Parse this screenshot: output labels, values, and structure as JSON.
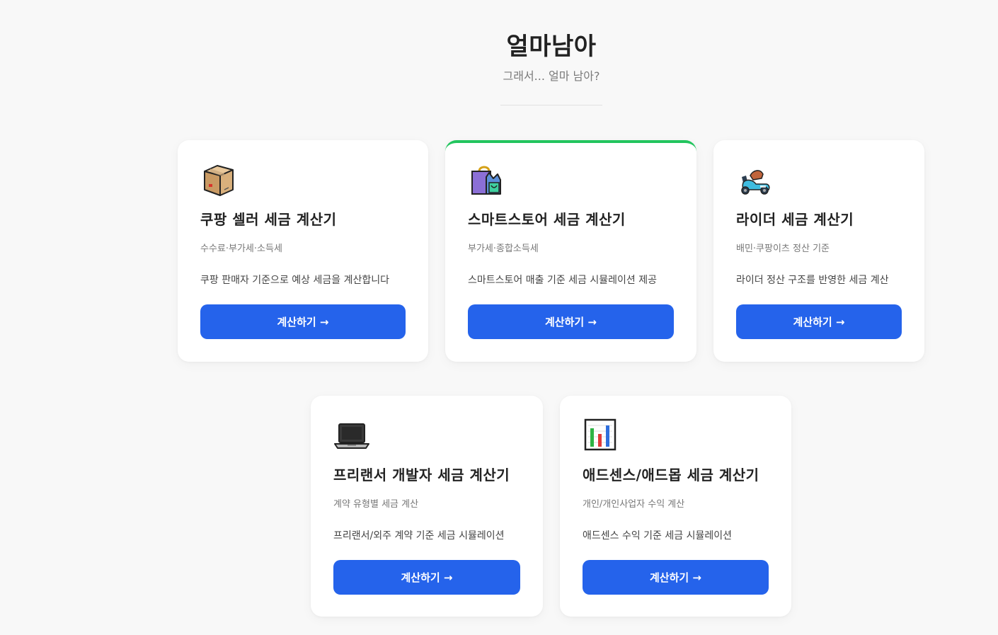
{
  "header": {
    "title": "얼마남아",
    "subtitle": "그래서... 얼마 남아?"
  },
  "cards": [
    {
      "icon": "package-icon",
      "title": "쿠팡 셀러 세금 계산기",
      "tags": "수수료·부가세·소득세",
      "description": "쿠팡 판매자 기준으로 예상 세금을 계산합니다",
      "button_label": "계산하기 →",
      "featured": false
    },
    {
      "icon": "shopping-bag-icon",
      "title": "스마트스토어 세금 계산기",
      "tags": "부가세·종합소득세",
      "description": "스마트스토어 매출 기준 세금 시뮬레이션 제공",
      "button_label": "계산하기 →",
      "featured": true,
      "accent_color": "#22c55e"
    },
    {
      "icon": "scooter-icon",
      "title": "라이더 세금 계산기",
      "tags": "배민·쿠팡이츠 정산 기준",
      "description": "라이더 정산 구조를 반영한 세금 계산",
      "button_label": "계산하기 →",
      "featured": false
    },
    {
      "icon": "laptop-icon",
      "title": "프리랜서 개발자 세금 계산기",
      "tags": "계약 유형별 세금 계산",
      "description": "프리랜서/외주 계약 기준 세금 시뮬레이션",
      "button_label": "계산하기 →",
      "featured": false
    },
    {
      "icon": "bar-chart-icon",
      "title": "애드센스/애드몹 세금 계산기",
      "tags": "개인/개인사업자 수익 계산",
      "description": "애드센스 수익 기준 세금 시뮬레이션",
      "button_label": "계산하기 →",
      "featured": false
    }
  ],
  "colors": {
    "background": "#f8f8f8",
    "button": "#2563eb",
    "featured_accent": "#22c55e"
  }
}
